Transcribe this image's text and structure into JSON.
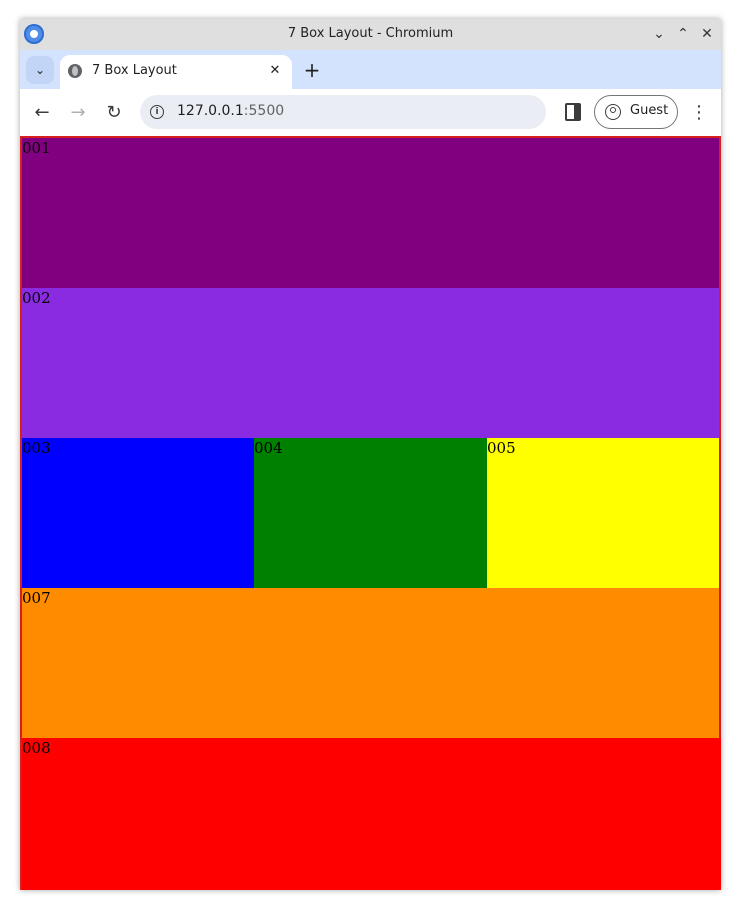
{
  "window": {
    "title": "7 Box Layout - Chromium",
    "controls": [
      "chevron-down-icon",
      "chevron-up-icon",
      "close-icon"
    ]
  },
  "tabs": [
    {
      "label": "7 Box Layout",
      "icon": "globe-icon",
      "active": true
    }
  ],
  "toolbar": {
    "url_host": "127.0.0.1",
    "url_port": ":5500",
    "profile_label": "Guest"
  },
  "boxes": [
    {
      "id": "001",
      "color": "#800080"
    },
    {
      "id": "002",
      "color": "#8a2be2"
    },
    {
      "id": "003",
      "color": "#0000ff"
    },
    {
      "id": "004",
      "color": "#008000"
    },
    {
      "id": "005",
      "color": "#ffff00"
    },
    {
      "id": "007",
      "color": "#ff8c00"
    },
    {
      "id": "008",
      "color": "#ff0000"
    }
  ],
  "page_border_color": "#d81f1f"
}
